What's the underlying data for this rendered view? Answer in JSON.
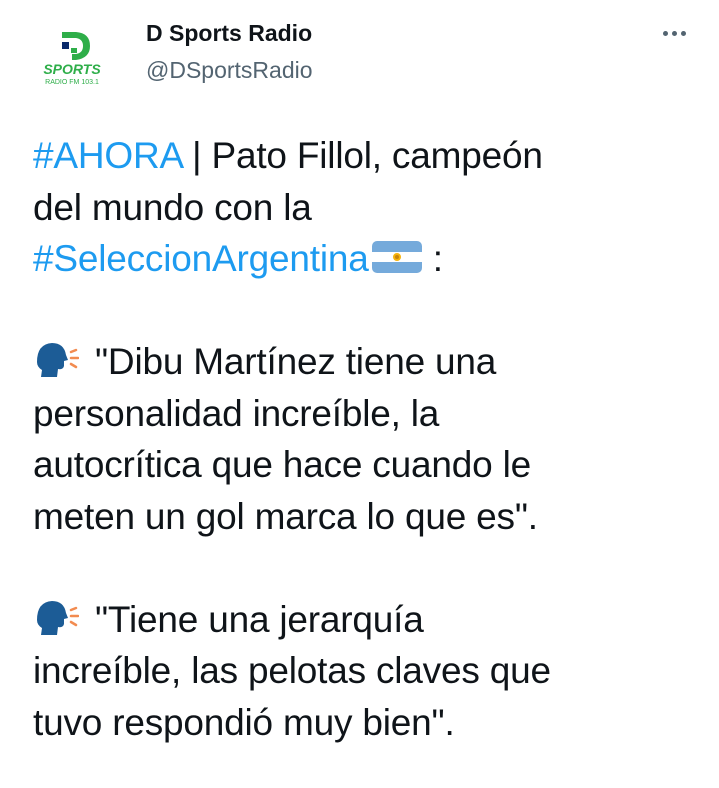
{
  "account": {
    "name": "D Sports Radio",
    "handle": "@DSportsRadio",
    "avatar_brand": "SPORTS",
    "avatar_sub": "RADIO FM 103.1",
    "avatar_letter": "D"
  },
  "icons": {
    "more": "more-horizontal-icon",
    "flag": "argentina-flag-emoji",
    "speaking": "speaking-head-emoji"
  },
  "colors": {
    "hashtag": "#1d9bf0",
    "text": "#0f1419",
    "secondary": "#536471",
    "brand_green": "#2eae49",
    "brand_blue": "#0a2a6b"
  },
  "tweet": {
    "hashtag_1": "#AHORA",
    "text_1": " | Pato Fillol, campeón",
    "text_2": "del mundo con la",
    "hashtag_2": "#SeleccionArgentina",
    "text_3": " :",
    "quote_1": [
      "\"Dibu Martínez tiene una",
      "personalidad increíble, la",
      "autocrítica que hace cuando le",
      "meten un gol marca lo que es\"."
    ],
    "quote_2": [
      "\"Tiene una jerarquía",
      "increíble, las pelotas claves que",
      "tuvo respondió muy bien\"."
    ]
  }
}
